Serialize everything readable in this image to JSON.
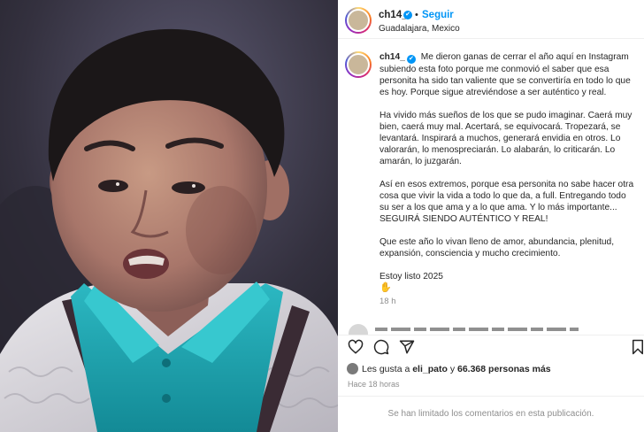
{
  "post": {
    "username": "ch14_",
    "verified_mark": "✔",
    "separator": "•",
    "follow_label": "Seguir",
    "location": "Guadalajara, Mexico"
  },
  "caption": {
    "username": "ch14_",
    "paragraphs": [
      "Me dieron ganas de cerrar el año aquí en Instagram subiendo esta foto porque me conmovió el saber que esa personita ha sido tan valiente que se convertiría en todo lo que es hoy. Porque sigue atreviéndose a ser auténtico y real.",
      "Ha vivido más sueños de los que se pudo imaginar. Caerá muy bien, caerá muy mal. Acertará, se equivocará. Tropezará, se levantará. Inspirará a muchos, generará envidia en otros. Lo valorarán, lo menospreciarán. Lo alabarán, lo criticarán. Lo amarán, lo juzgarán.",
      "Así en esos extremos, porque esa personita no sabe hacer otra cosa que vivir la vida a todo lo que da, a full. Entregando todo su ser a los que ama y a lo que ama. Y lo más importante... SEGUIRÁ SIENDO AUTÉNTICO Y REAL!",
      "Que este año lo vivan lleno de amor, abundancia, plenitud, expansión, consciencia y mucho crecimiento.",
      "Estoy listo 2025"
    ],
    "emoji": "✋",
    "time": "18 h"
  },
  "likes": {
    "prefix": "Les gusta a",
    "user": "eli_pato",
    "middle": "y",
    "count": "66.368 personas más"
  },
  "post_date": "Hace 18 horas",
  "comments_limited": "Se han limitado los comentarios en esta publicación.",
  "icons": [
    "heart-icon",
    "comment-icon",
    "share-icon",
    "bookmark-icon",
    "verified-icon"
  ],
  "colors": {
    "accent": "#0095f6",
    "muted": "#8e8e8e",
    "text": "#262626",
    "shirt": "#1fa7b0"
  }
}
